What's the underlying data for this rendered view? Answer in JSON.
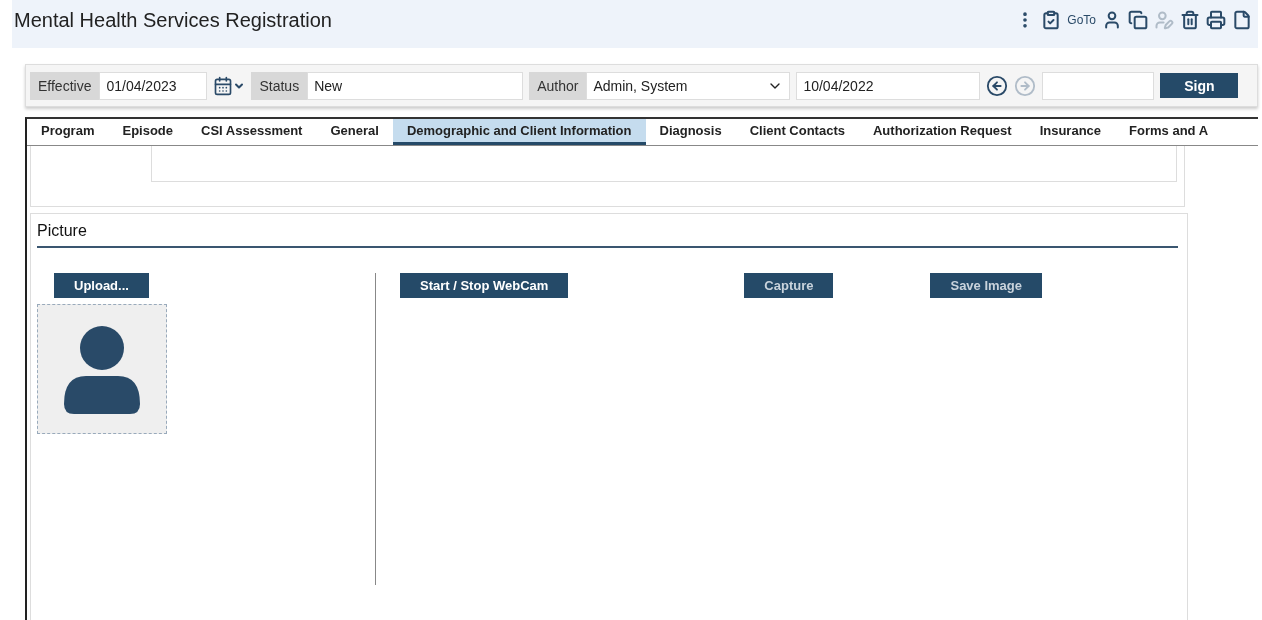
{
  "window": {
    "title": "Mental Health Services Registration"
  },
  "toolbar": {
    "goto_label": "GoTo",
    "icons": [
      {
        "kind": "kebab",
        "disabled": false
      },
      {
        "kind": "clipboard",
        "disabled": false
      },
      {
        "kind": "goto",
        "disabled": false
      },
      {
        "kind": "user",
        "disabled": false
      },
      {
        "kind": "copy",
        "disabled": false
      },
      {
        "kind": "user-edit",
        "disabled": true
      },
      {
        "kind": "trash",
        "disabled": false
      },
      {
        "kind": "print",
        "disabled": false
      },
      {
        "kind": "file",
        "disabled": false
      }
    ]
  },
  "header_bar": {
    "effective_label": "Effective",
    "effective_value": "01/04/2023",
    "status_label": "Status",
    "status_value": "New",
    "author_label": "Author",
    "author_value": "Admin, System",
    "date_value": "10/04/2022",
    "sign_label": "Sign"
  },
  "tabs": [
    {
      "label": "Program",
      "selected": false
    },
    {
      "label": "Episode",
      "selected": false
    },
    {
      "label": "CSI Assessment",
      "selected": false
    },
    {
      "label": "General",
      "selected": false
    },
    {
      "label": "Demographic and Client Information",
      "selected": true
    },
    {
      "label": "Diagnosis",
      "selected": false
    },
    {
      "label": "Client Contacts",
      "selected": false
    },
    {
      "label": "Authorization Request",
      "selected": false
    },
    {
      "label": "Insurance",
      "selected": false
    },
    {
      "label": "Forms and A",
      "selected": false
    }
  ],
  "picture_section": {
    "title": "Picture",
    "upload_label": "Upload...",
    "buttons": [
      {
        "label": "Start / Stop WebCam",
        "disabled": false
      },
      {
        "label": "Capture",
        "disabled": true
      },
      {
        "label": "Save Image",
        "disabled": true
      }
    ]
  }
}
